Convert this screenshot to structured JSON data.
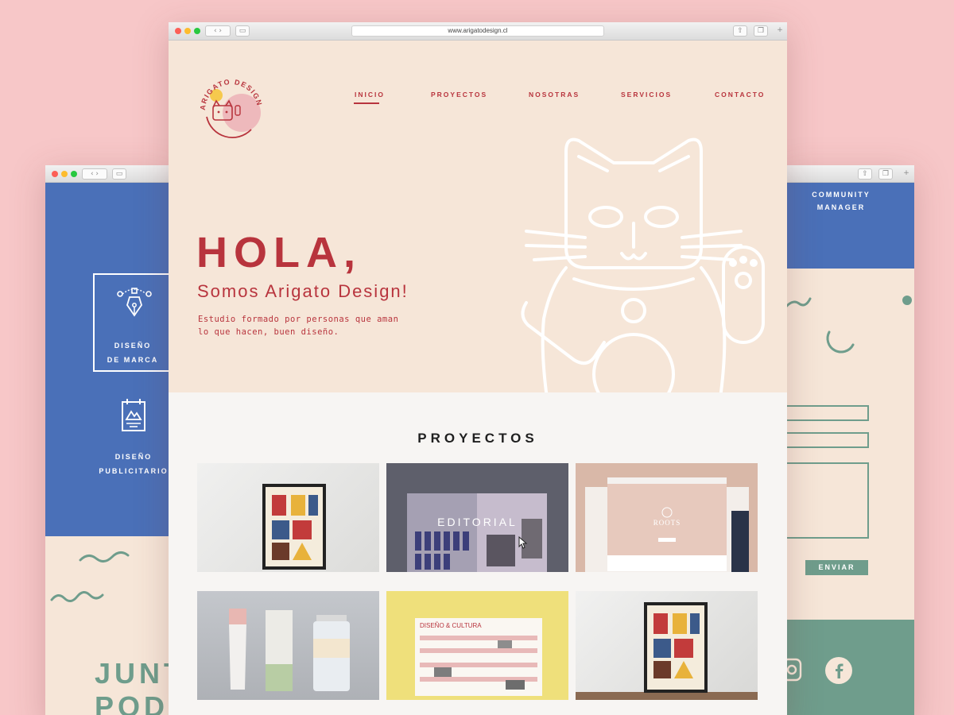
{
  "main_window": {
    "url": "www.arigatodesign.cl",
    "logo_text": "ARIGATO DESIGN",
    "nav": [
      "INICIO",
      "PROYECTOS",
      "NOSOTRAS",
      "SERVICIOS",
      "CONTACTO"
    ],
    "active_nav": "INICIO",
    "hero": {
      "heading": "HOLA,",
      "subheading": "Somos Arigato Design!",
      "description_line1": "Estudio formado por personas que aman",
      "description_line2": "lo que hacen, buen diseño."
    },
    "projects": {
      "title": "PROYECTOS",
      "hover_label": "EDITORIAL"
    }
  },
  "left_window": {
    "service1_line1": "DISEÑO",
    "service1_line2": "DE MARCA",
    "service2_line1": "DISEÑO",
    "service2_line2": "PUBLICITARIO",
    "bottom_line1": "JUNT",
    "bottom_line2": "PODE"
  },
  "right_window": {
    "label_line1": "COMMUNITY",
    "label_line2": "MANAGER",
    "send_button": "ENVIAR"
  },
  "colors": {
    "background": "#f7c7c8",
    "cream": "#f6e6d8",
    "brand_red": "#b8343d",
    "blue": "#4a70b8",
    "green": "#6f9d8c"
  }
}
